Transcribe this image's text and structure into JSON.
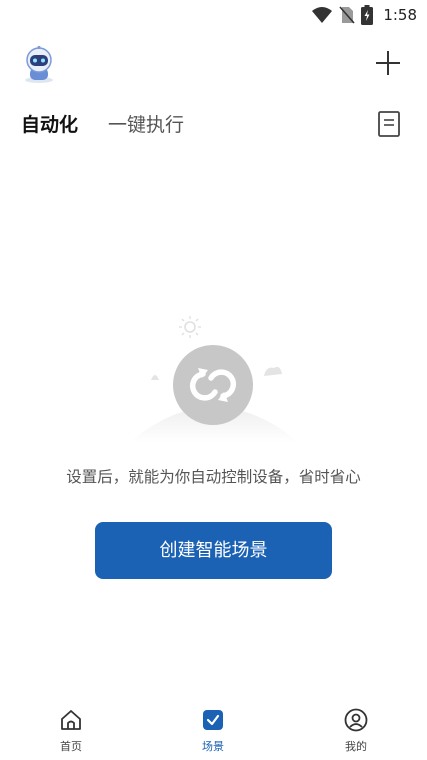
{
  "status_bar": {
    "time": "1:58",
    "icons": [
      "wifi-icon",
      "no-sim-icon",
      "battery-charging-icon"
    ]
  },
  "header": {
    "avatar_icon": "robot-avatar-icon",
    "add_icon": "plus-icon"
  },
  "tabs": [
    {
      "label": "自动化",
      "active": true
    },
    {
      "label": "一键执行",
      "active": false
    }
  ],
  "log_icon": "document-icon",
  "empty_state": {
    "illustration_icon": "loop-icon",
    "text": "设置后，就能为你自动控制设备，省时省心",
    "button_label": "创建智能场景"
  },
  "bottom_nav": [
    {
      "label": "首页",
      "icon": "home-icon",
      "active": false
    },
    {
      "label": "场景",
      "icon": "scene-check-icon",
      "active": true
    },
    {
      "label": "我的",
      "icon": "profile-icon",
      "active": false
    }
  ],
  "colors": {
    "accent": "#1b62b5",
    "text_primary": "#111111",
    "text_secondary": "#555555"
  }
}
